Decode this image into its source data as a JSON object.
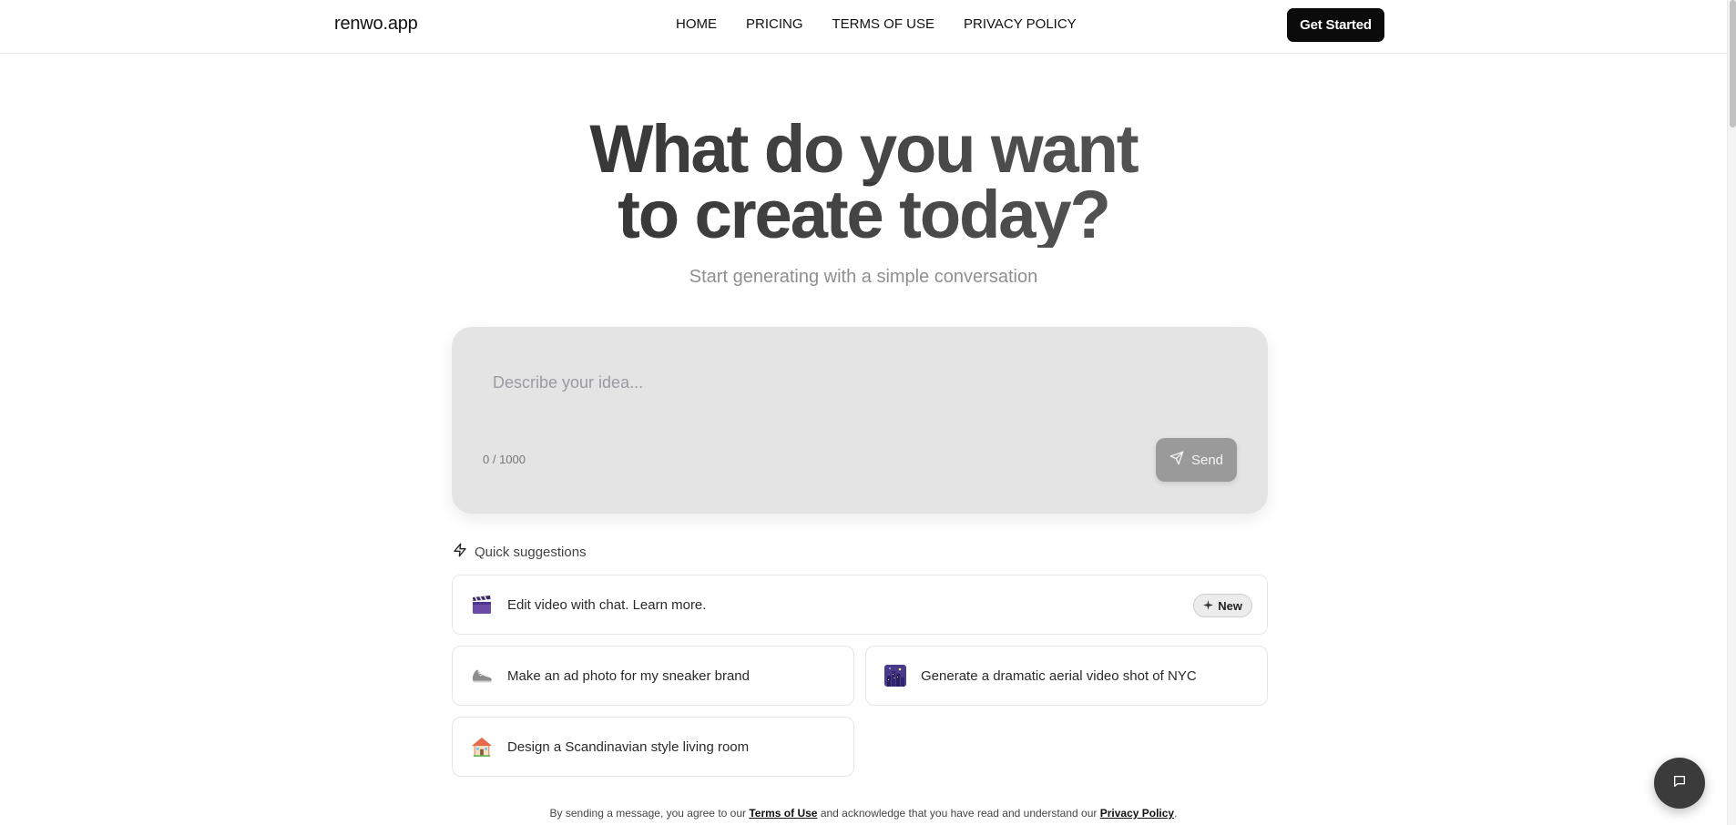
{
  "header": {
    "brand": "renwo.app",
    "nav": [
      "HOME",
      "PRICING",
      "TERMS OF USE",
      "PRIVACY POLICY"
    ],
    "cta_label": "Get Started"
  },
  "hero": {
    "title_line1": "What do you want",
    "title_line2": "to create today?",
    "subtitle": "Start generating with a simple conversation"
  },
  "prompt": {
    "placeholder": "Describe your idea...",
    "value": "",
    "char_count": "0 / 1000",
    "send_label": "Send"
  },
  "suggestions": {
    "header": "Quick suggestions",
    "items": [
      {
        "icon": "clapperboard-icon",
        "label": "Edit video with chat. Learn more.",
        "badge": "New"
      },
      {
        "icon": "sneaker-icon",
        "label": "Make an ad photo for my sneaker brand"
      },
      {
        "icon": "night-city-icon",
        "label": "Generate a dramatic aerial video shot of NYC"
      },
      {
        "icon": "house-icon",
        "label": "Design a Scandinavian style living room"
      }
    ]
  },
  "legal": {
    "prefix": "By sending a message, you agree to our ",
    "terms_link": "Terms of Use",
    "middle": " and acknowledge that you have read and understand our ",
    "privacy_link": "Privacy Policy",
    "suffix": "."
  },
  "colors": {
    "accent": "#0b0b0b",
    "prompt_bg": "#e4e4e4",
    "send_bg": "#9a9a9a",
    "chat_bubble": "#3b3b3b"
  }
}
